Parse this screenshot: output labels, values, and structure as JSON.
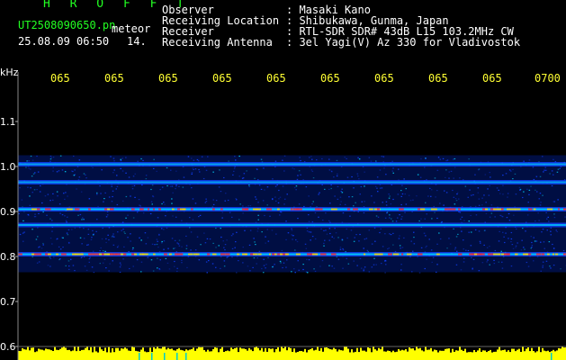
{
  "header": {
    "title": "H R O F F T",
    "filename": "UT2508090650.pn",
    "suffix": "meteor",
    "datetime": "25.08.09 06:50",
    "meteor_count": "14.",
    "info": [
      {
        "label": "Observer",
        "value": ": Masaki Kano"
      },
      {
        "label": "Receiving Location",
        "value": ": Shibukawa, Gunma, Japan"
      },
      {
        "label": "Receiver",
        "value": ": RTL-SDR SDR# 43dB L15 103.2MHz CW"
      },
      {
        "label": "Receiving Antenna",
        "value": ": 3el Yagi(V) Az 330 for Vladivostok"
      }
    ]
  },
  "colors": {
    "background": "#000000",
    "axis_text": "#ffffff",
    "time_labels": "#ffff33",
    "title_text": "#22ff22",
    "noise_floor": "#001a7a",
    "signal_low": "#1040ff",
    "signal_mid": "#00d8ff",
    "signal_high": "#ff3030",
    "amplitude_bars": "#ffff00",
    "amplitude_gap": "#00cccc"
  },
  "chart_data": {
    "type": "heatmap",
    "ylabel": "kHz",
    "y_ticks": [
      "1.1",
      "1.0",
      "0.9",
      "0.8",
      "0.7",
      "0.6"
    ],
    "ylim": [
      0.57,
      1.2
    ],
    "x_ticks": [
      "065",
      "065",
      "065",
      "065",
      "065",
      "065",
      "065",
      "065",
      "065",
      "0700"
    ],
    "bands": [
      {
        "freq_khz": 1.005,
        "strength": 0.45
      },
      {
        "freq_khz": 0.965,
        "strength": 0.35
      },
      {
        "freq_khz": 0.905,
        "strength": 1.0
      },
      {
        "freq_khz": 0.87,
        "strength": 0.55
      },
      {
        "freq_khz": 0.805,
        "strength": 0.95
      }
    ],
    "amplitude_strip_khz": [
      0.575,
      0.6
    ]
  }
}
